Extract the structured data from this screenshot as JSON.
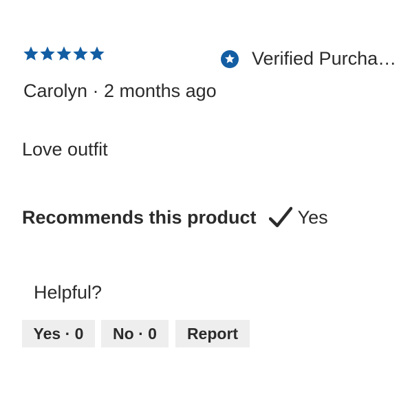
{
  "review": {
    "rating": 5,
    "rating_max": 5,
    "star_color": "#135da3",
    "verified_label": "Verified Purcha…",
    "verified_icon": "star-badge-icon",
    "author_line": "Carolyn · 2 months ago",
    "body": "Love outfit",
    "recommend_label": "Recommends this product",
    "recommend_icon": "checkmark-icon",
    "recommend_value": "Yes"
  },
  "helpful": {
    "label": "Helpful?",
    "yes_button": "Yes · 0",
    "no_button": "No · 0",
    "report_button": "Report"
  }
}
